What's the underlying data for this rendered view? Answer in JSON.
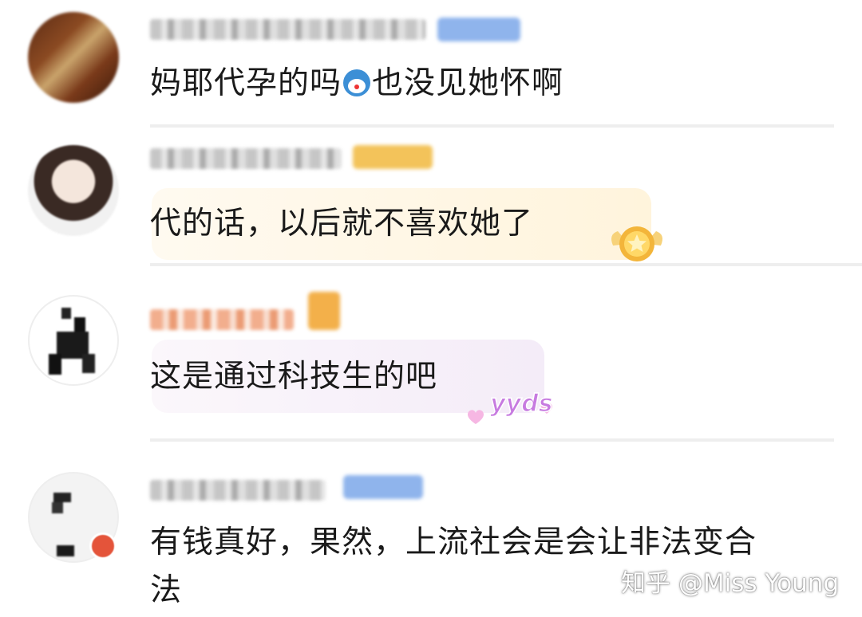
{
  "comments": [
    {
      "text": "妈耶代孕的吗",
      "text_after_emoji": "也没见她怀啊",
      "emoji": "doraemon-emoji"
    },
    {
      "text": "代的话，以后就不喜欢她了"
    },
    {
      "text": "这是通过科技生的吧",
      "sticker": "yyds"
    },
    {
      "text_line1": "有钱真好，果然，上流社会是会让非法变合",
      "text_line2": "法"
    }
  ],
  "watermark": "知乎 @Miss Young",
  "colors": {
    "badge_blue": "#8fb4ec",
    "badge_gold": "#f3c35a",
    "bubble_gold": "#fff6e2",
    "bubble_pink": "#f6eef8"
  }
}
